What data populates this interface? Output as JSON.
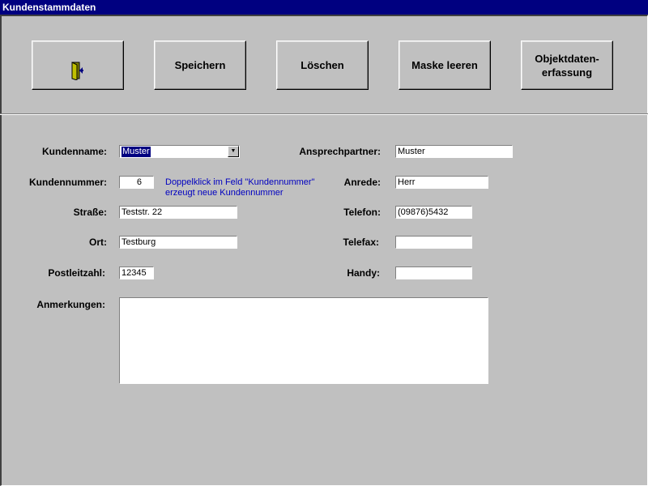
{
  "window": {
    "title": "Kundenstammdaten"
  },
  "toolbar": {
    "exit_icon": "exit-door-icon",
    "save_label": "Speichern",
    "delete_label": "Löschen",
    "clear_label": "Maske leeren",
    "object_label": "Objektdaten-\nerfassung"
  },
  "form": {
    "customer_name": {
      "label": "Kundenname:",
      "value": "Muster"
    },
    "customer_number": {
      "label": "Kundennummer:",
      "value": "6"
    },
    "hint": "Doppelklick im Feld \"Kundennummer\" erzeugt neue Kundennummer",
    "street": {
      "label": "Straße:",
      "value": "Teststr. 22"
    },
    "city": {
      "label": "Ort:",
      "value": "Testburg"
    },
    "postal_code": {
      "label": "Postleitzahl:",
      "value": "12345"
    },
    "contact_person": {
      "label": "Ansprechpartner:",
      "value": "Muster"
    },
    "salutation": {
      "label": "Anrede:",
      "value": "Herr"
    },
    "phone": {
      "label": "Telefon:",
      "value": "(09876)5432"
    },
    "fax": {
      "label": "Telefax:",
      "value": ""
    },
    "mobile": {
      "label": "Handy:",
      "value": ""
    },
    "remarks": {
      "label": "Anmerkungen:",
      "value": ""
    }
  },
  "colors": {
    "title_bar": "#000080",
    "background": "#c0c0c0",
    "hint_text": "#0000c0"
  }
}
